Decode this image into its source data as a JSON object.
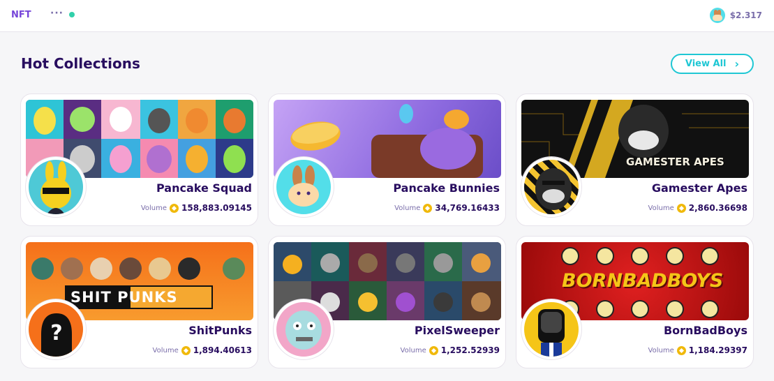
{
  "topbar": {
    "nft_label": "NFT",
    "more_label": "···",
    "cake_price": "$2.317"
  },
  "section": {
    "title": "Hot Collections",
    "view_all_label": "View All",
    "view_all_arrow": "›"
  },
  "collections": [
    {
      "name": "Pancake Squad",
      "volume_label": "Volume",
      "volume": "158,883.09145"
    },
    {
      "name": "Pancake Bunnies",
      "volume_label": "Volume",
      "volume": "34,769.16433"
    },
    {
      "name": "Gamester Apes",
      "volume_label": "Volume",
      "volume": "2,860.36698",
      "banner_text": "GAMESTER APES"
    },
    {
      "name": "ShitPunks",
      "volume_label": "Volume",
      "volume": "1,894.40613",
      "banner_text": "SHIT PUNKS"
    },
    {
      "name": "PixelSweeper",
      "volume_label": "Volume",
      "volume": "1,252.52939"
    },
    {
      "name": "BornBadBoys",
      "volume_label": "Volume",
      "volume": "1,184.29397",
      "banner_text": "BORNBADBOYS"
    }
  ],
  "colors": {
    "primary": "#1fc7d4",
    "secondary": "#7645d9",
    "text": "#280d5f",
    "text_subtle": "#7a6eaa",
    "success": "#31d0aa"
  },
  "icons": {
    "price_icon": "pancake-bunny-icon",
    "currency_icon": "bnb-coin-icon"
  }
}
